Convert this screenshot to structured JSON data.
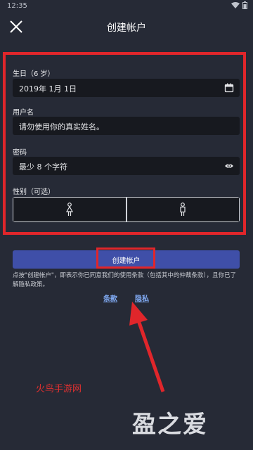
{
  "status": {
    "time": "12:35"
  },
  "header": {
    "title": "创建帐户"
  },
  "form": {
    "birthday_label": "生日（6 岁）",
    "birthday_value": "2019年 1月 1日",
    "username_label": "用户名",
    "username_placeholder": "请勿使用你的真实姓名。",
    "password_label": "密码",
    "password_placeholder": "最少 8 个字符",
    "gender_label": "性别（可选）"
  },
  "create_button_label": "创建帐户",
  "terms_text": "点按\"创建帐户\"，即表示你已同意我们的使用条款（包括其中的仲裁条款），且你已了解隐私政策。",
  "links": {
    "terms": "条款",
    "privacy": "隐私"
  },
  "watermarks": {
    "site": "火鸟手游网",
    "brand": "盈之爱"
  },
  "colors": {
    "background": "#262a36",
    "field": "#17191f",
    "button": "#3f4fa8",
    "highlight": "#e0262b",
    "link": "#7fa8f0"
  },
  "icons": [
    "close-icon",
    "calendar-icon",
    "eye-icon",
    "female-icon",
    "male-icon",
    "wifi-icon",
    "battery-icon"
  ]
}
